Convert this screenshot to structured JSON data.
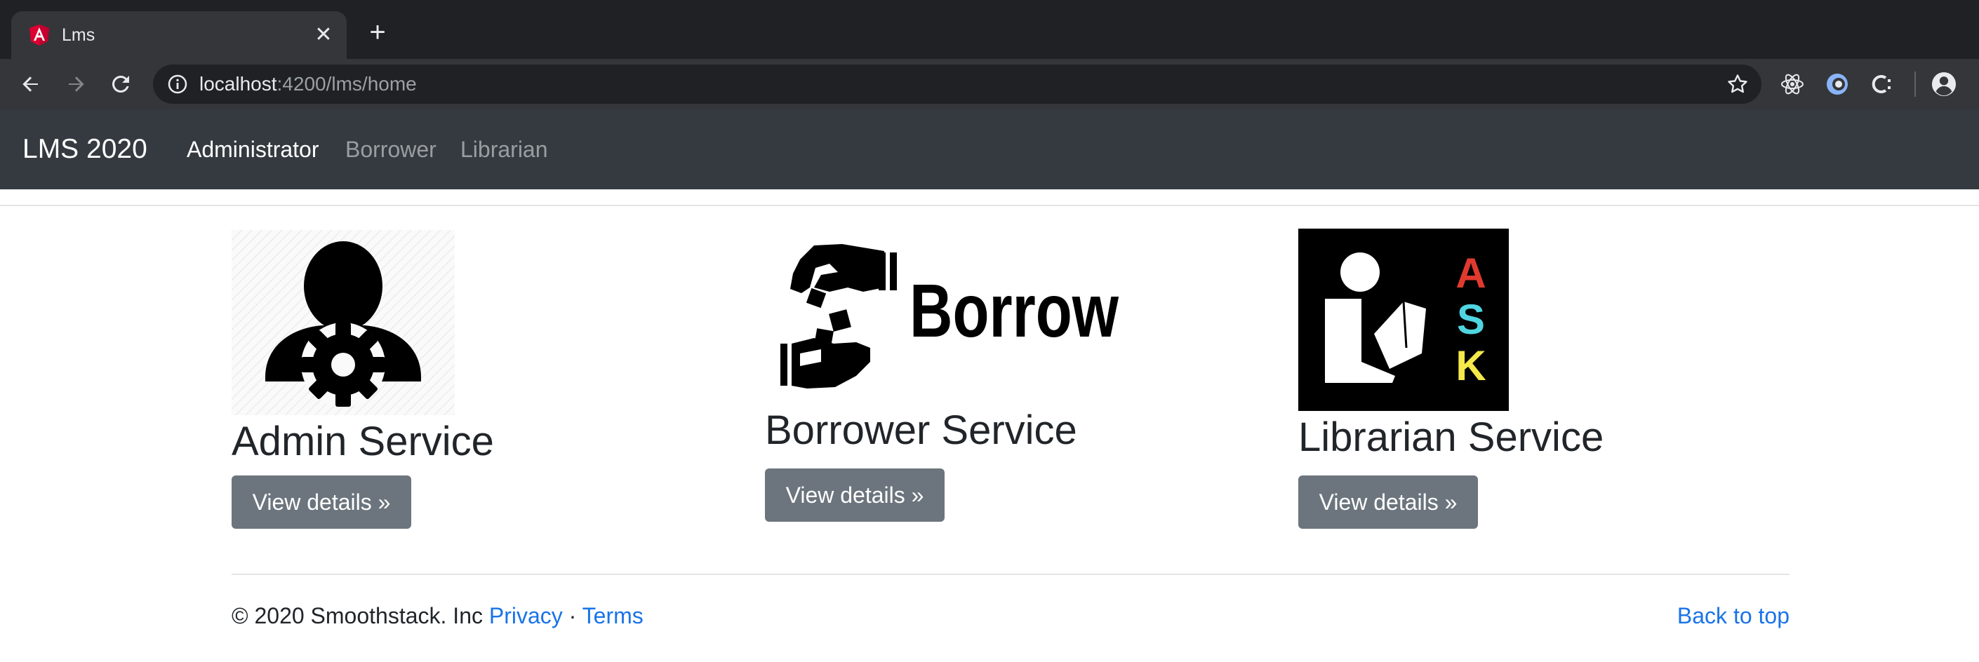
{
  "browser": {
    "tab_title": "Lms",
    "url_host": "localhost",
    "url_rest": ":4200/lms/home"
  },
  "navbar": {
    "brand": "LMS 2020",
    "links": [
      "Administrator",
      "Borrower",
      "Librarian"
    ]
  },
  "services": [
    {
      "title": "Admin Service",
      "button": "View details »",
      "image": "admin-gear-person-icon"
    },
    {
      "title": "Borrower Service",
      "button": "View details »",
      "image": "borrow-hands-logo",
      "logo_text": "Borrow"
    },
    {
      "title": "Librarian Service",
      "button": "View details »",
      "image": "ask-librarian-logo",
      "logo_letters": [
        "A",
        "S",
        "K"
      ]
    }
  ],
  "footer": {
    "copyright": "© 2020 Smoothstack. Inc",
    "privacy": "Privacy",
    "separator": "·",
    "terms": "Terms",
    "back_to_top": "Back to top"
  },
  "colors": {
    "navbar_bg": "#343a40",
    "button_bg": "#6c757d",
    "link": "#1a73e8",
    "ask_a": "#e03a2f",
    "ask_s": "#4fd6e0",
    "ask_k": "#f5e84a"
  }
}
